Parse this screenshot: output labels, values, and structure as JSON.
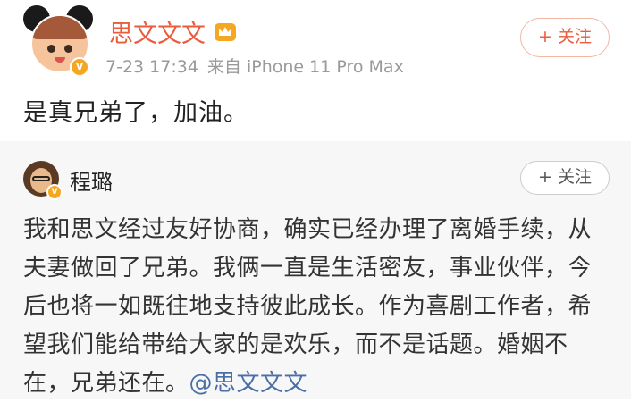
{
  "post": {
    "username": "思文文文",
    "date": "7-23 17:34",
    "source": "来自 iPhone 11 Pro Max",
    "follow_label": "+ 关注",
    "text": "是真兄弟了，加油。"
  },
  "repost": {
    "username": "程璐",
    "follow_label": "+ 关注",
    "body": "我和思文经过友好协商，确实已经办理了离婚手续，从夫妻做回了兄弟。我俩一直是生活密友，事业伙伴，今后也将一如既往地支持彼此成长。作为喜剧工作者，希望我们能给带给大家的是欢乐，而不是话题。婚姻不在，兄弟还在。",
    "mention": "@思文文文"
  },
  "colors": {
    "username": "#ea5c3c",
    "mention": "#4a6fa5",
    "repost_bg": "#f7f7f7",
    "meta": "#9a9a9a"
  }
}
